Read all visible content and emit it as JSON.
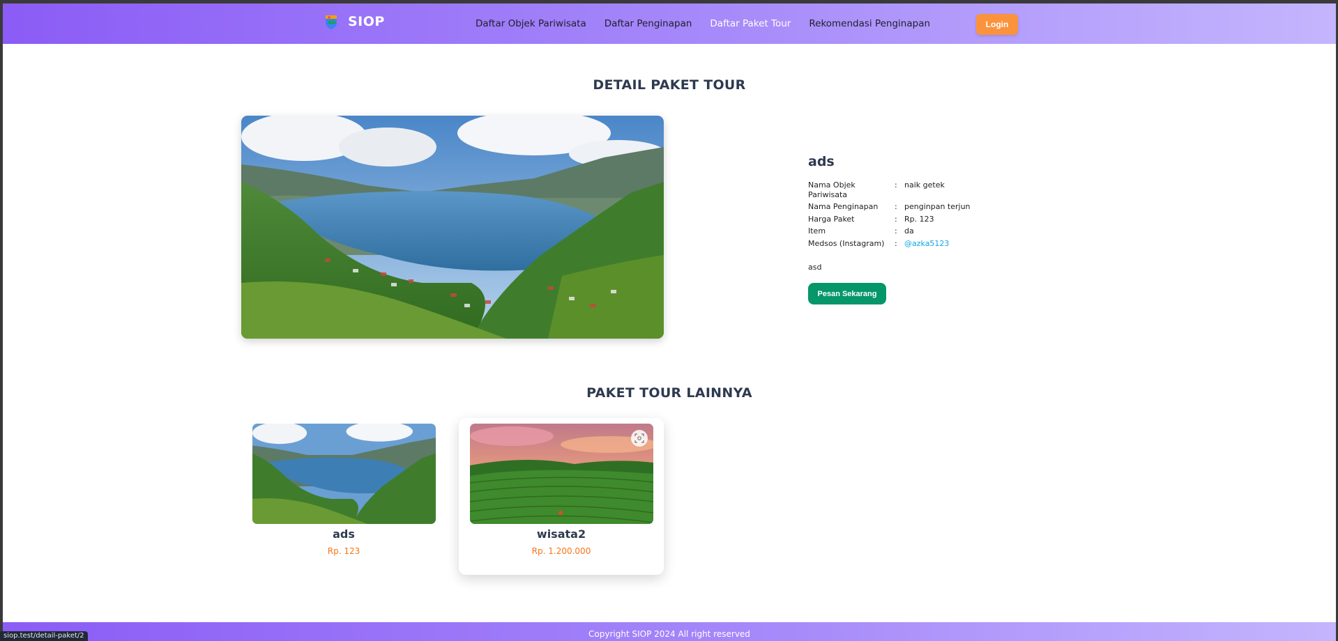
{
  "navbar": {
    "brand": "SIOP",
    "links": [
      {
        "label": "Daftar Objek Pariwisata",
        "active": false
      },
      {
        "label": "Daftar Penginapan",
        "active": false
      },
      {
        "label": "Daftar Paket Tour",
        "active": true
      },
      {
        "label": "Rekomendasi Penginapan",
        "active": false
      }
    ],
    "login_label": "Login"
  },
  "detail": {
    "section_title": "DETAIL PAKET TOUR",
    "name": "ads",
    "fields": [
      {
        "label": "Nama Objek Pariwisata",
        "sep": ":",
        "value": "naik getek"
      },
      {
        "label": "Nama Penginapan",
        "sep": ":",
        "value": "penginpan terjun"
      },
      {
        "label": "Harga Paket",
        "sep": ":",
        "value": "Rp. 123"
      },
      {
        "label": "Item",
        "sep": ":",
        "value": "da"
      },
      {
        "label": "Medsos (Instagram)",
        "sep": ":",
        "value": "@azka5123"
      }
    ],
    "description": "asd",
    "order_label": "Pesan Sekarang"
  },
  "others": {
    "section_title": "PAKET TOUR LAINNYA",
    "cards": [
      {
        "name": "ads",
        "price": "Rp. 123"
      },
      {
        "name": "wisata2",
        "price": "Rp. 1.200.000"
      }
    ]
  },
  "footer": {
    "text": "Copyright SIOP 2024 All right reserved"
  },
  "status_bar": {
    "url": "siop.test/detail-paket/2"
  },
  "colors": {
    "nav_gradient_start": "#8b5cf6",
    "login_button": "#fb923c",
    "order_button": "#059669",
    "price": "#f97316",
    "link": "#0ea5e9"
  }
}
